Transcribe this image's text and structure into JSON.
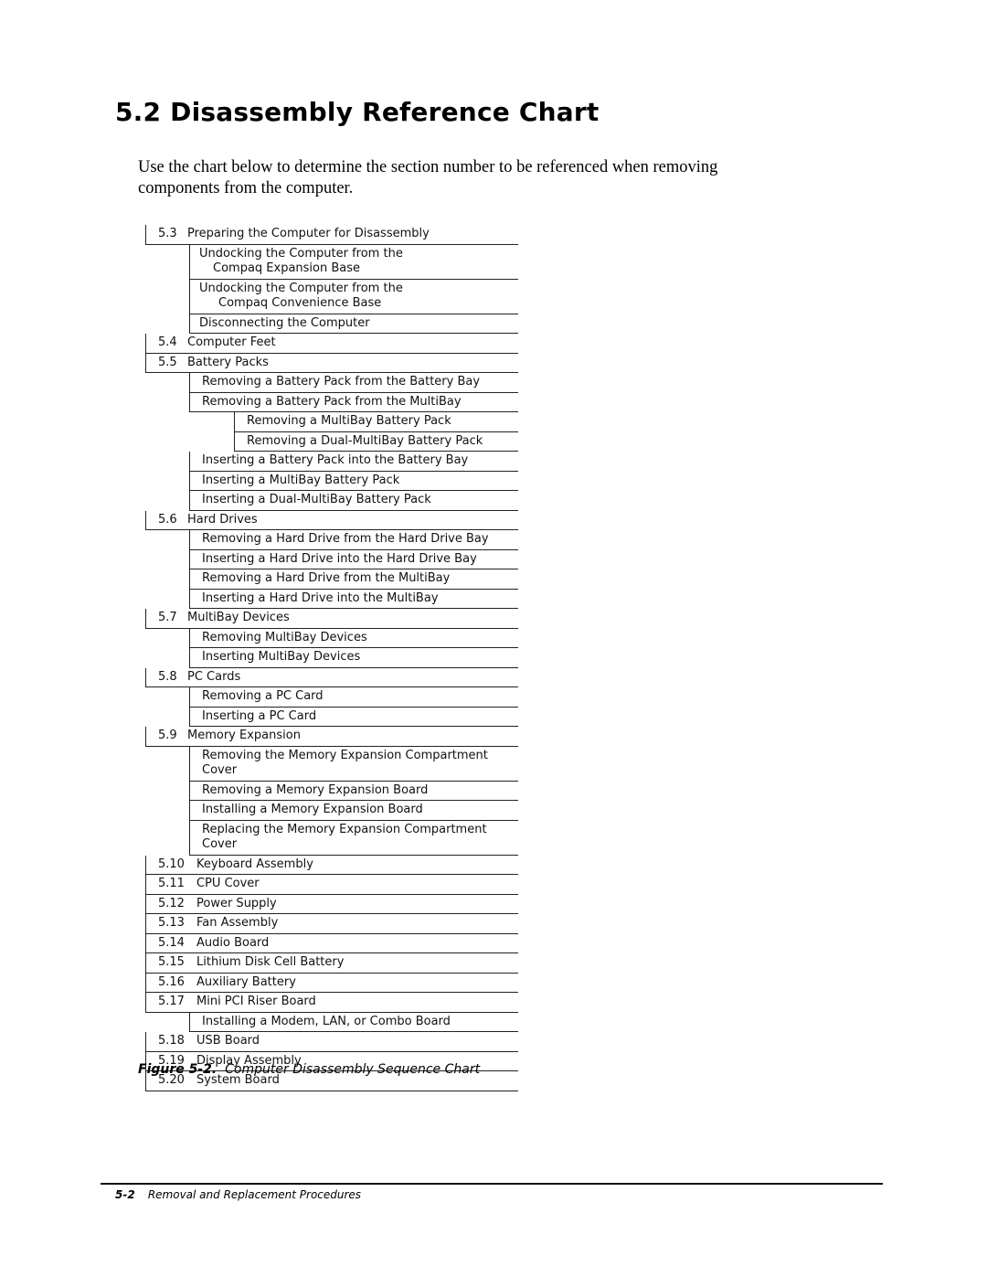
{
  "heading": "5.2  Disassembly Reference Chart",
  "intro": "Use the chart below to determine the section number to be referenced when removing components from the computer.",
  "chart": [
    {
      "level": 1,
      "num": "5.3",
      "text": "Preparing the Computer for Disassembly",
      "first": true
    },
    {
      "level": 2,
      "text": "Undocking the Computer from the",
      "cont": "Compaq Expansion Base",
      "contIndent": "a"
    },
    {
      "level": 2,
      "text": "Undocking the Computer from the",
      "cont": "Compaq Convenience Base",
      "contIndent": "b"
    },
    {
      "level": 2,
      "text": "Disconnecting the Computer"
    },
    {
      "level": 1,
      "num": "5.4",
      "text": "Computer Feet"
    },
    {
      "level": 1,
      "num": "5.5",
      "text": "Battery Packs"
    },
    {
      "level": 2,
      "text": "Removing a Battery Pack from the Battery Bay"
    },
    {
      "level": 2,
      "text": "Removing a Battery Pack from the MultiBay"
    },
    {
      "level": 3,
      "text": "Removing a MultiBay Battery Pack"
    },
    {
      "level": 3,
      "text": "Removing a Dual-MultiBay Battery Pack"
    },
    {
      "level": 2,
      "text": "Inserting a Battery Pack into the Battery Bay"
    },
    {
      "level": 2,
      "text": "Inserting a MultiBay Battery Pack"
    },
    {
      "level": 2,
      "text": "Inserting a Dual-MultiBay Battery Pack"
    },
    {
      "level": 1,
      "num": "5.6",
      "text": "Hard Drives"
    },
    {
      "level": 2,
      "text": "Removing a Hard Drive from the Hard Drive Bay"
    },
    {
      "level": 2,
      "text": "Inserting a Hard Drive into the Hard Drive Bay"
    },
    {
      "level": 2,
      "text": "Removing a Hard Drive from the MultiBay"
    },
    {
      "level": 2,
      "text": "Inserting a Hard Drive into the MultiBay"
    },
    {
      "level": 1,
      "num": "5.7",
      "text": "MultiBay Devices"
    },
    {
      "level": 2,
      "text": "Removing MultiBay Devices"
    },
    {
      "level": 2,
      "text": "Inserting MultiBay Devices"
    },
    {
      "level": 1,
      "num": "5.8",
      "text": "PC Cards"
    },
    {
      "level": 2,
      "text": "Removing a PC Card"
    },
    {
      "level": 2,
      "text": "Inserting a PC Card"
    },
    {
      "level": 1,
      "num": "5.9",
      "text": "Memory Expansion"
    },
    {
      "level": 2,
      "text": "Removing the Memory Expansion Compartment",
      "cont": "Cover",
      "contIndent": "flush"
    },
    {
      "level": 2,
      "text": "Removing a Memory Expansion Board"
    },
    {
      "level": 2,
      "text": "Installing a Memory Expansion Board"
    },
    {
      "level": 2,
      "text": "Replacing the Memory Expansion Compartment",
      "cont": "Cover",
      "contIndent": "flush"
    },
    {
      "level": 1,
      "num": "5.10",
      "text": "Keyboard Assembly"
    },
    {
      "level": 1,
      "num": "5.11",
      "text": "CPU Cover"
    },
    {
      "level": 1,
      "num": "5.12",
      "text": "Power Supply"
    },
    {
      "level": 1,
      "num": "5.13",
      "text": "Fan Assembly"
    },
    {
      "level": 1,
      "num": "5.14",
      "text": "Audio Board"
    },
    {
      "level": 1,
      "num": "5.15",
      "text": "Lithium Disk Cell Battery"
    },
    {
      "level": 1,
      "num": "5.16",
      "text": "Auxiliary Battery"
    },
    {
      "level": 1,
      "num": "5.17",
      "text": "Mini PCI Riser Board"
    },
    {
      "level": 2,
      "text": "Installing a Modem, LAN, or Combo Board"
    },
    {
      "level": 1,
      "num": "5.18",
      "text": "USB Board"
    },
    {
      "level": 1,
      "num": "5.19",
      "text": "Display Assembly"
    },
    {
      "level": 1,
      "num": "5.20",
      "text": "System Board"
    }
  ],
  "caption": {
    "label": "Figure 5-2.",
    "text": "Computer Disassembly Sequence Chart"
  },
  "footer": {
    "page": "5-2",
    "section": "Removal and Replacement Procedures"
  }
}
